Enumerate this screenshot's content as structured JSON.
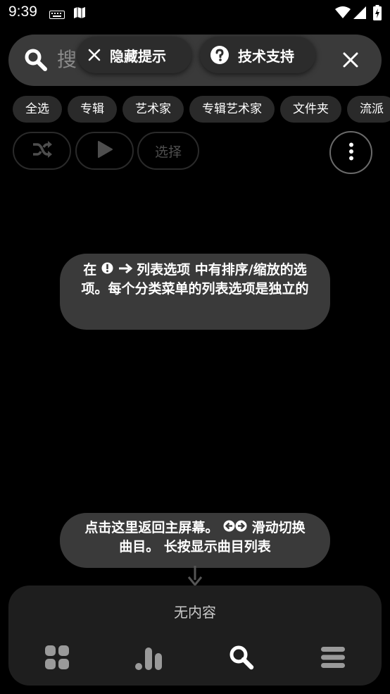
{
  "status_bar": {
    "time": "9:39"
  },
  "search": {
    "text": "搜"
  },
  "overlay_tips": {
    "hide_tips": "隐藏提示",
    "tech_support": "技术支持"
  },
  "filters": [
    "全选",
    "专辑",
    "艺术家",
    "专辑艺术家",
    "文件夹",
    "流派"
  ],
  "actions": {
    "select": "选择"
  },
  "tooltips": {
    "sort_prefix": "在",
    "sort_text": "列表选项 中有排序/缩放的选项。每个分类菜单的列表选项是独立的",
    "nav_line1": "点击这里返回主屏幕。",
    "nav_line1_suffix": "滑动切换",
    "nav_line2": "曲目。 长按显示曲目列表"
  },
  "player": {
    "empty_text": "无内容"
  },
  "colors": {
    "background": "#000000",
    "surface": "#3a3a3a",
    "chip": "#2a2a2a",
    "panel": "#1e1e1e"
  }
}
